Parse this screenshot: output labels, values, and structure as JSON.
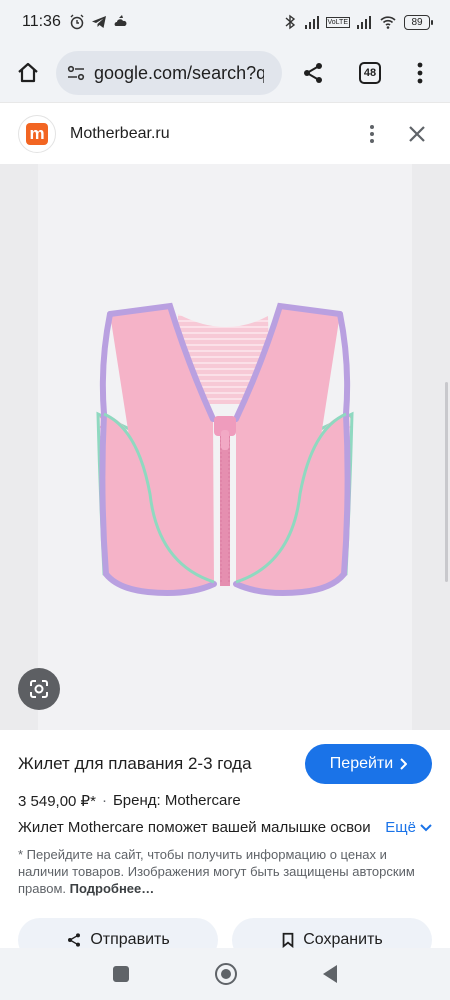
{
  "status_bar": {
    "time": "11:36",
    "battery": "89",
    "volte_label": "VoLTE"
  },
  "browser": {
    "url": "google.com/search?q",
    "tab_count": "48"
  },
  "site": {
    "logo_letter": "m",
    "logo_color": "#f26522",
    "name": "Motherbear.ru"
  },
  "product": {
    "title": "Жилет для плавания 2-3 года",
    "go_button": "Перейти",
    "price": "3 549,00 ₽*",
    "separator": "·",
    "brand": "Бренд: Mothercare",
    "description": "Жилет Mothercare поможет вашей малышке освоить плавание",
    "more_label": "Ещё",
    "note": "* Перейдите на сайт, чтобы получить информацию о ценах и наличии товаров. Изображения могут быть защищены авторским правом.",
    "note_more": "Подробнее…"
  },
  "actions": {
    "send_label": "Отправить",
    "save_label": "Сохранить"
  },
  "colors": {
    "accent": "#1a73e8",
    "vest_pink": "#f5b3c8",
    "vest_trim": "#b9a0e0",
    "vest_mint": "#8fd9c0"
  }
}
